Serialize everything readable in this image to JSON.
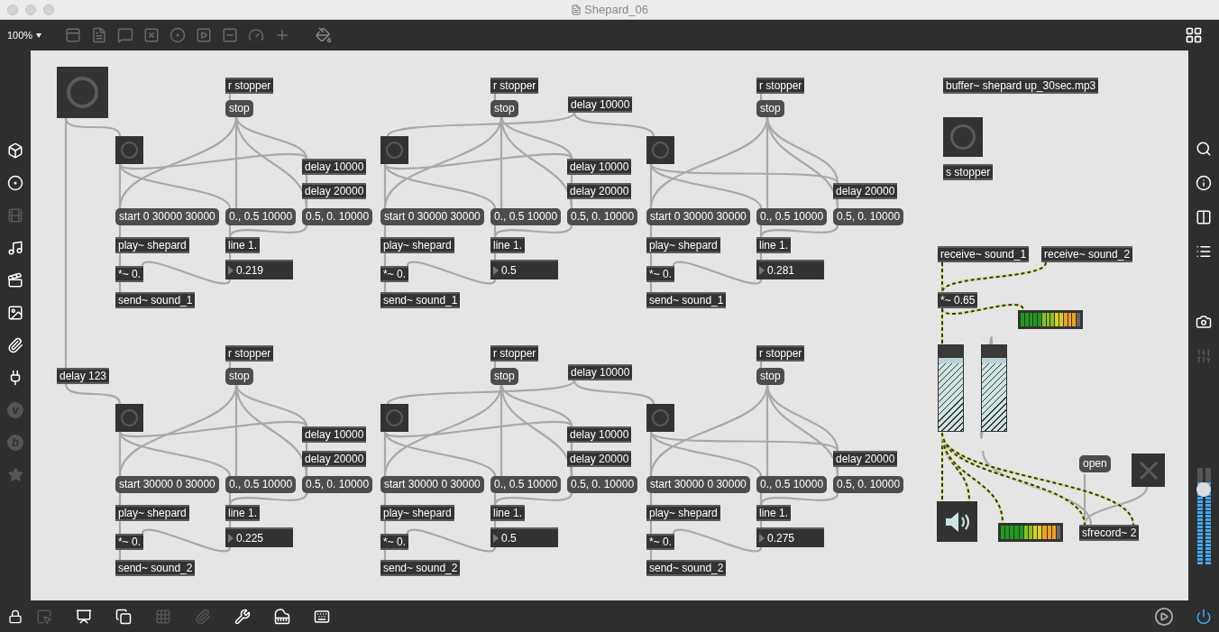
{
  "window": {
    "title": "Shepard_06"
  },
  "toolbar": {
    "zoom": "100%"
  },
  "patch": {
    "start_delay": "delay 123",
    "rows": [
      {
        "top_delay": "delay 10000",
        "voices": [
          {
            "receive": "r stopper",
            "stop": "stop",
            "delays": [
              "delay 10000",
              "delay 20000"
            ],
            "start": "start 0 30000 30000",
            "fade_in": "0., 0.5 10000",
            "fade_out": "0.5, 0. 10000",
            "player": "play~ shepard",
            "line": "line 1.",
            "value": "0.219",
            "gain": "*~ 0.",
            "send": "send~ sound_1"
          },
          {
            "receive": "r stopper",
            "stop": "stop",
            "delays": [
              "delay 10000",
              "delay 20000"
            ],
            "start": "start 0 30000 30000",
            "fade_in": "0., 0.5 10000",
            "fade_out": "0.5, 0. 10000",
            "player": "play~ shepard",
            "line": "line 1.",
            "value": "0.5",
            "gain": "*~ 0.",
            "send": "send~ sound_1"
          },
          {
            "receive": "r stopper",
            "stop": "stop",
            "delays": [
              "delay 20000"
            ],
            "start": "start 0 30000 30000",
            "fade_in": "0., 0.5 10000",
            "fade_out": "0.5, 0. 10000",
            "player": "play~ shepard",
            "line": "line 1.",
            "value": "0.281",
            "gain": "*~ 0.",
            "send": "send~ sound_1"
          }
        ]
      },
      {
        "top_delay": "delay 10000",
        "voices": [
          {
            "receive": "r stopper",
            "stop": "stop",
            "delays": [
              "delay 10000",
              "delay 20000"
            ],
            "start": "start 30000 0 30000",
            "fade_in": "0., 0.5 10000",
            "fade_out": "0.5, 0. 10000",
            "player": "play~ shepard",
            "line": "line 1.",
            "value": "0.225",
            "gain": "*~ 0.",
            "send": "send~ sound_2"
          },
          {
            "receive": "r stopper",
            "stop": "stop",
            "delays": [
              "delay 10000",
              "delay 20000"
            ],
            "start": "start 30000 0 30000",
            "fade_in": "0., 0.5 10000",
            "fade_out": "0.5, 0. 10000",
            "player": "play~ shepard",
            "line": "line 1.",
            "value": "0.5",
            "gain": "*~ 0.",
            "send": "send~ sound_2"
          },
          {
            "receive": "r stopper",
            "stop": "stop",
            "delays": [
              "delay 20000"
            ],
            "start": "start 30000 0 30000",
            "fade_in": "0., 0.5 10000",
            "fade_out": "0.5, 0. 10000",
            "player": "play~ shepard",
            "line": "line 1.",
            "value": "0.275",
            "gain": "*~ 0.",
            "send": "send~ sound_2"
          }
        ]
      }
    ],
    "output": {
      "buffer": "buffer~ shepard up_30sec.mp3",
      "stop_send": "s stopper",
      "receives": [
        "receive~ sound_1",
        "receive~ sound_2"
      ],
      "master_gain": "*~ 0.65",
      "meters": [
        {
          "level": 0.93
        },
        {
          "level": 0.92
        }
      ],
      "faders": [
        {
          "level": 0.85
        },
        {
          "level": 0.85
        }
      ],
      "open": "open",
      "record_toggle": {
        "checked": false
      },
      "recorder": "sfrecord~ 2"
    }
  },
  "sidebar": {
    "letters": [
      "v",
      "b"
    ]
  },
  "master_volume": {
    "level": 0.85
  }
}
